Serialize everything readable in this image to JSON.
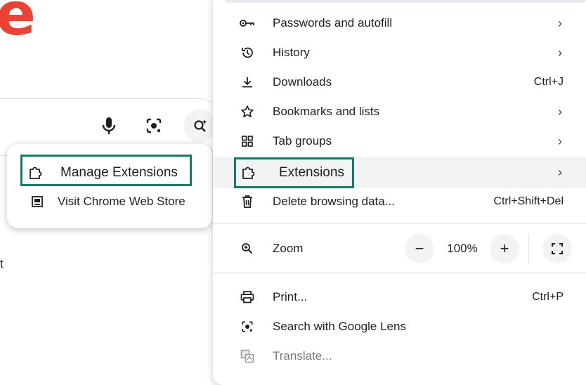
{
  "background": {
    "logo_fragment": "e",
    "side_text": "t"
  },
  "submenu": {
    "items": [
      {
        "label": "Manage Extensions",
        "icon": "puzzle-piece-icon"
      },
      {
        "label": "Visit Chrome Web Store",
        "icon": "web-store-icon"
      }
    ]
  },
  "menu": {
    "items": [
      {
        "label": "Passwords and autofill",
        "icon": "key-icon",
        "has_submenu": true
      },
      {
        "label": "History",
        "icon": "history-icon",
        "has_submenu": true
      },
      {
        "label": "Downloads",
        "icon": "download-icon",
        "shortcut": "Ctrl+J"
      },
      {
        "label": "Bookmarks and lists",
        "icon": "star-icon",
        "has_submenu": true
      },
      {
        "label": "Tab groups",
        "icon": "tab-groups-icon",
        "has_submenu": true
      },
      {
        "label": "Extensions",
        "icon": "puzzle-piece-icon",
        "has_submenu": true,
        "active": true
      },
      {
        "label": "Delete browsing data...",
        "icon": "trash-icon",
        "shortcut": "Ctrl+Shift+Del"
      }
    ],
    "zoom": {
      "label": "Zoom",
      "value": "100%",
      "minus": "−",
      "plus": "+"
    },
    "bottom_items": [
      {
        "label": "Print...",
        "icon": "print-icon",
        "shortcut": "Ctrl+P"
      },
      {
        "label": "Search with Google Lens",
        "icon": "google-lens-icon"
      },
      {
        "label": "Translate...",
        "icon": "translate-icon",
        "disabled": true
      }
    ]
  },
  "colors": {
    "highlight_border": "#0f7d68",
    "logo_red": "#ea4335",
    "active_row": "#f1f3f4"
  }
}
